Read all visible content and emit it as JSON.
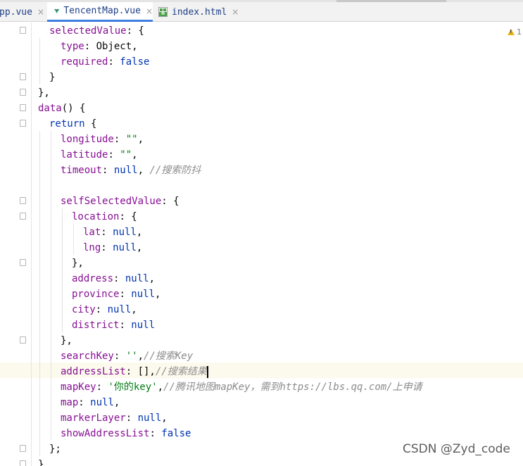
{
  "tabs": [
    {
      "label": "App.vue",
      "visible_label": "pp.vue",
      "active": false
    },
    {
      "label": "TencentMap.vue",
      "active": true
    },
    {
      "label": "index.html",
      "active": false
    }
  ],
  "close_glyph": "×",
  "warning": {
    "count": "1"
  },
  "colors": {
    "keyword": "#0033b3",
    "property": "#871094",
    "string": "#067d17",
    "comment": "#8c8c8c",
    "active_tab_underline": "#3d7fe0",
    "current_line": "#fcfaed"
  },
  "code": [
    [
      {
        "t": "selectedValue",
        "k": "p"
      },
      {
        "t": ": {",
        "k": "d"
      }
    ],
    [
      {
        "t": "type",
        "k": "p"
      },
      {
        "t": ": Object,",
        "k": "d"
      }
    ],
    [
      {
        "t": "required",
        "k": "p"
      },
      {
        "t": ": ",
        "k": "d"
      },
      {
        "t": "false",
        "k": "k"
      }
    ],
    [
      {
        "t": "}",
        "k": "d"
      }
    ],
    [
      {
        "t": "},",
        "k": "d"
      }
    ],
    [
      {
        "t": "data",
        "k": "p"
      },
      {
        "t": "() {",
        "k": "d"
      }
    ],
    [
      {
        "t": "return",
        "k": "k"
      },
      {
        "t": " {",
        "k": "d"
      }
    ],
    [
      {
        "t": "longitude",
        "k": "p"
      },
      {
        "t": ": ",
        "k": "d"
      },
      {
        "t": "\"\"",
        "k": "s"
      },
      {
        "t": ",",
        "k": "d"
      }
    ],
    [
      {
        "t": "latitude",
        "k": "p"
      },
      {
        "t": ": ",
        "k": "d"
      },
      {
        "t": "\"\"",
        "k": "s"
      },
      {
        "t": ",",
        "k": "d"
      }
    ],
    [
      {
        "t": "timeout",
        "k": "p"
      },
      {
        "t": ": ",
        "k": "d"
      },
      {
        "t": "null",
        "k": "k"
      },
      {
        "t": ", ",
        "k": "d"
      },
      {
        "t": "//搜索防抖",
        "k": "c"
      }
    ],
    [],
    [
      {
        "t": "selfSelectedValue",
        "k": "p"
      },
      {
        "t": ": {",
        "k": "d"
      }
    ],
    [
      {
        "t": "location",
        "k": "p"
      },
      {
        "t": ": {",
        "k": "d"
      }
    ],
    [
      {
        "t": "lat",
        "k": "p"
      },
      {
        "t": ": ",
        "k": "d"
      },
      {
        "t": "null",
        "k": "k"
      },
      {
        "t": ",",
        "k": "d"
      }
    ],
    [
      {
        "t": "lng",
        "k": "p"
      },
      {
        "t": ": ",
        "k": "d"
      },
      {
        "t": "null",
        "k": "k"
      },
      {
        "t": ",",
        "k": "d"
      }
    ],
    [
      {
        "t": "},",
        "k": "d"
      }
    ],
    [
      {
        "t": "address",
        "k": "p"
      },
      {
        "t": ": ",
        "k": "d"
      },
      {
        "t": "null",
        "k": "k"
      },
      {
        "t": ",",
        "k": "d"
      }
    ],
    [
      {
        "t": "province",
        "k": "p"
      },
      {
        "t": ": ",
        "k": "d"
      },
      {
        "t": "null",
        "k": "k"
      },
      {
        "t": ",",
        "k": "d"
      }
    ],
    [
      {
        "t": "city",
        "k": "p"
      },
      {
        "t": ": ",
        "k": "d"
      },
      {
        "t": "null",
        "k": "k"
      },
      {
        "t": ",",
        "k": "d"
      }
    ],
    [
      {
        "t": "district",
        "k": "p"
      },
      {
        "t": ": ",
        "k": "d"
      },
      {
        "t": "null",
        "k": "k"
      }
    ],
    [
      {
        "t": "},",
        "k": "d"
      }
    ],
    [
      {
        "t": "searchKey",
        "k": "p"
      },
      {
        "t": ": ",
        "k": "d"
      },
      {
        "t": "''",
        "k": "s"
      },
      {
        "t": ",",
        "k": "d"
      },
      {
        "t": "//搜索Key",
        "k": "c"
      }
    ],
    [
      {
        "t": "addressList",
        "k": "p"
      },
      {
        "t": ": [],",
        "k": "d"
      },
      {
        "t": "//搜索结果",
        "k": "c"
      }
    ],
    [
      {
        "t": "mapKey",
        "k": "p"
      },
      {
        "t": ": ",
        "k": "d"
      },
      {
        "t": "'你的key'",
        "k": "s"
      },
      {
        "t": ",",
        "k": "d"
      },
      {
        "t": "//腾讯地图mapKey，需到https://lbs.qq.com/上申请",
        "k": "c"
      }
    ],
    [
      {
        "t": "map",
        "k": "p"
      },
      {
        "t": ": ",
        "k": "d"
      },
      {
        "t": "null",
        "k": "k"
      },
      {
        "t": ",",
        "k": "d"
      }
    ],
    [
      {
        "t": "markerLayer",
        "k": "p"
      },
      {
        "t": ": ",
        "k": "d"
      },
      {
        "t": "null",
        "k": "k"
      },
      {
        "t": ",",
        "k": "d"
      }
    ],
    [
      {
        "t": "showAddressList",
        "k": "p"
      },
      {
        "t": ": ",
        "k": "d"
      },
      {
        "t": "false",
        "k": "k"
      }
    ],
    [
      {
        "t": "};",
        "k": "d"
      }
    ],
    [
      {
        "t": "}",
        "k": "d"
      }
    ]
  ],
  "watermark": "CSDN @Zyd_code"
}
